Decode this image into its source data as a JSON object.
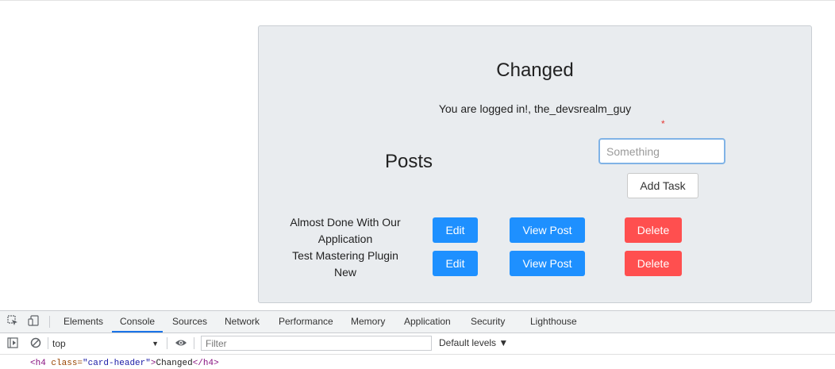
{
  "app": {
    "card_title": "Changed",
    "login_text": "You are logged in!, the_devsrealm_guy",
    "required_marker": "*",
    "posts_heading": "Posts",
    "task_input": {
      "placeholder": "Something",
      "value": ""
    },
    "add_task_label": "Add Task",
    "posts": [
      {
        "title": "Almost Done With Our Application",
        "edit": "Edit",
        "view": "View Post",
        "delete": "Delete"
      },
      {
        "title": "Test Mastering Plugin New",
        "edit": "Edit",
        "view": "View Post",
        "delete": "Delete"
      }
    ]
  },
  "devtools": {
    "tabs": [
      "Elements",
      "Console",
      "Sources",
      "Network",
      "Performance",
      "Memory",
      "Application",
      "Security",
      "Lighthouse"
    ],
    "active_tab": "Console",
    "context": "top",
    "filter_placeholder": "Filter",
    "levels_label": "Default levels ▼",
    "console_output": {
      "open_tag": "<h4",
      "attr_name": "class=",
      "attr_value": "\"card-header\"",
      "close_open": ">",
      "text": "Changed",
      "close_tag": "</h4>"
    }
  },
  "colors": {
    "primary": "#1e90ff",
    "danger": "#ff4f4f",
    "card_bg": "#e9ecef",
    "input_focus": "#80b3e6",
    "devtools_accent": "#1a73e8"
  },
  "icons": [
    "inspect-icon",
    "device-toggle-icon",
    "sidebar-toggle-icon",
    "clear-console-icon",
    "eye-icon"
  ]
}
